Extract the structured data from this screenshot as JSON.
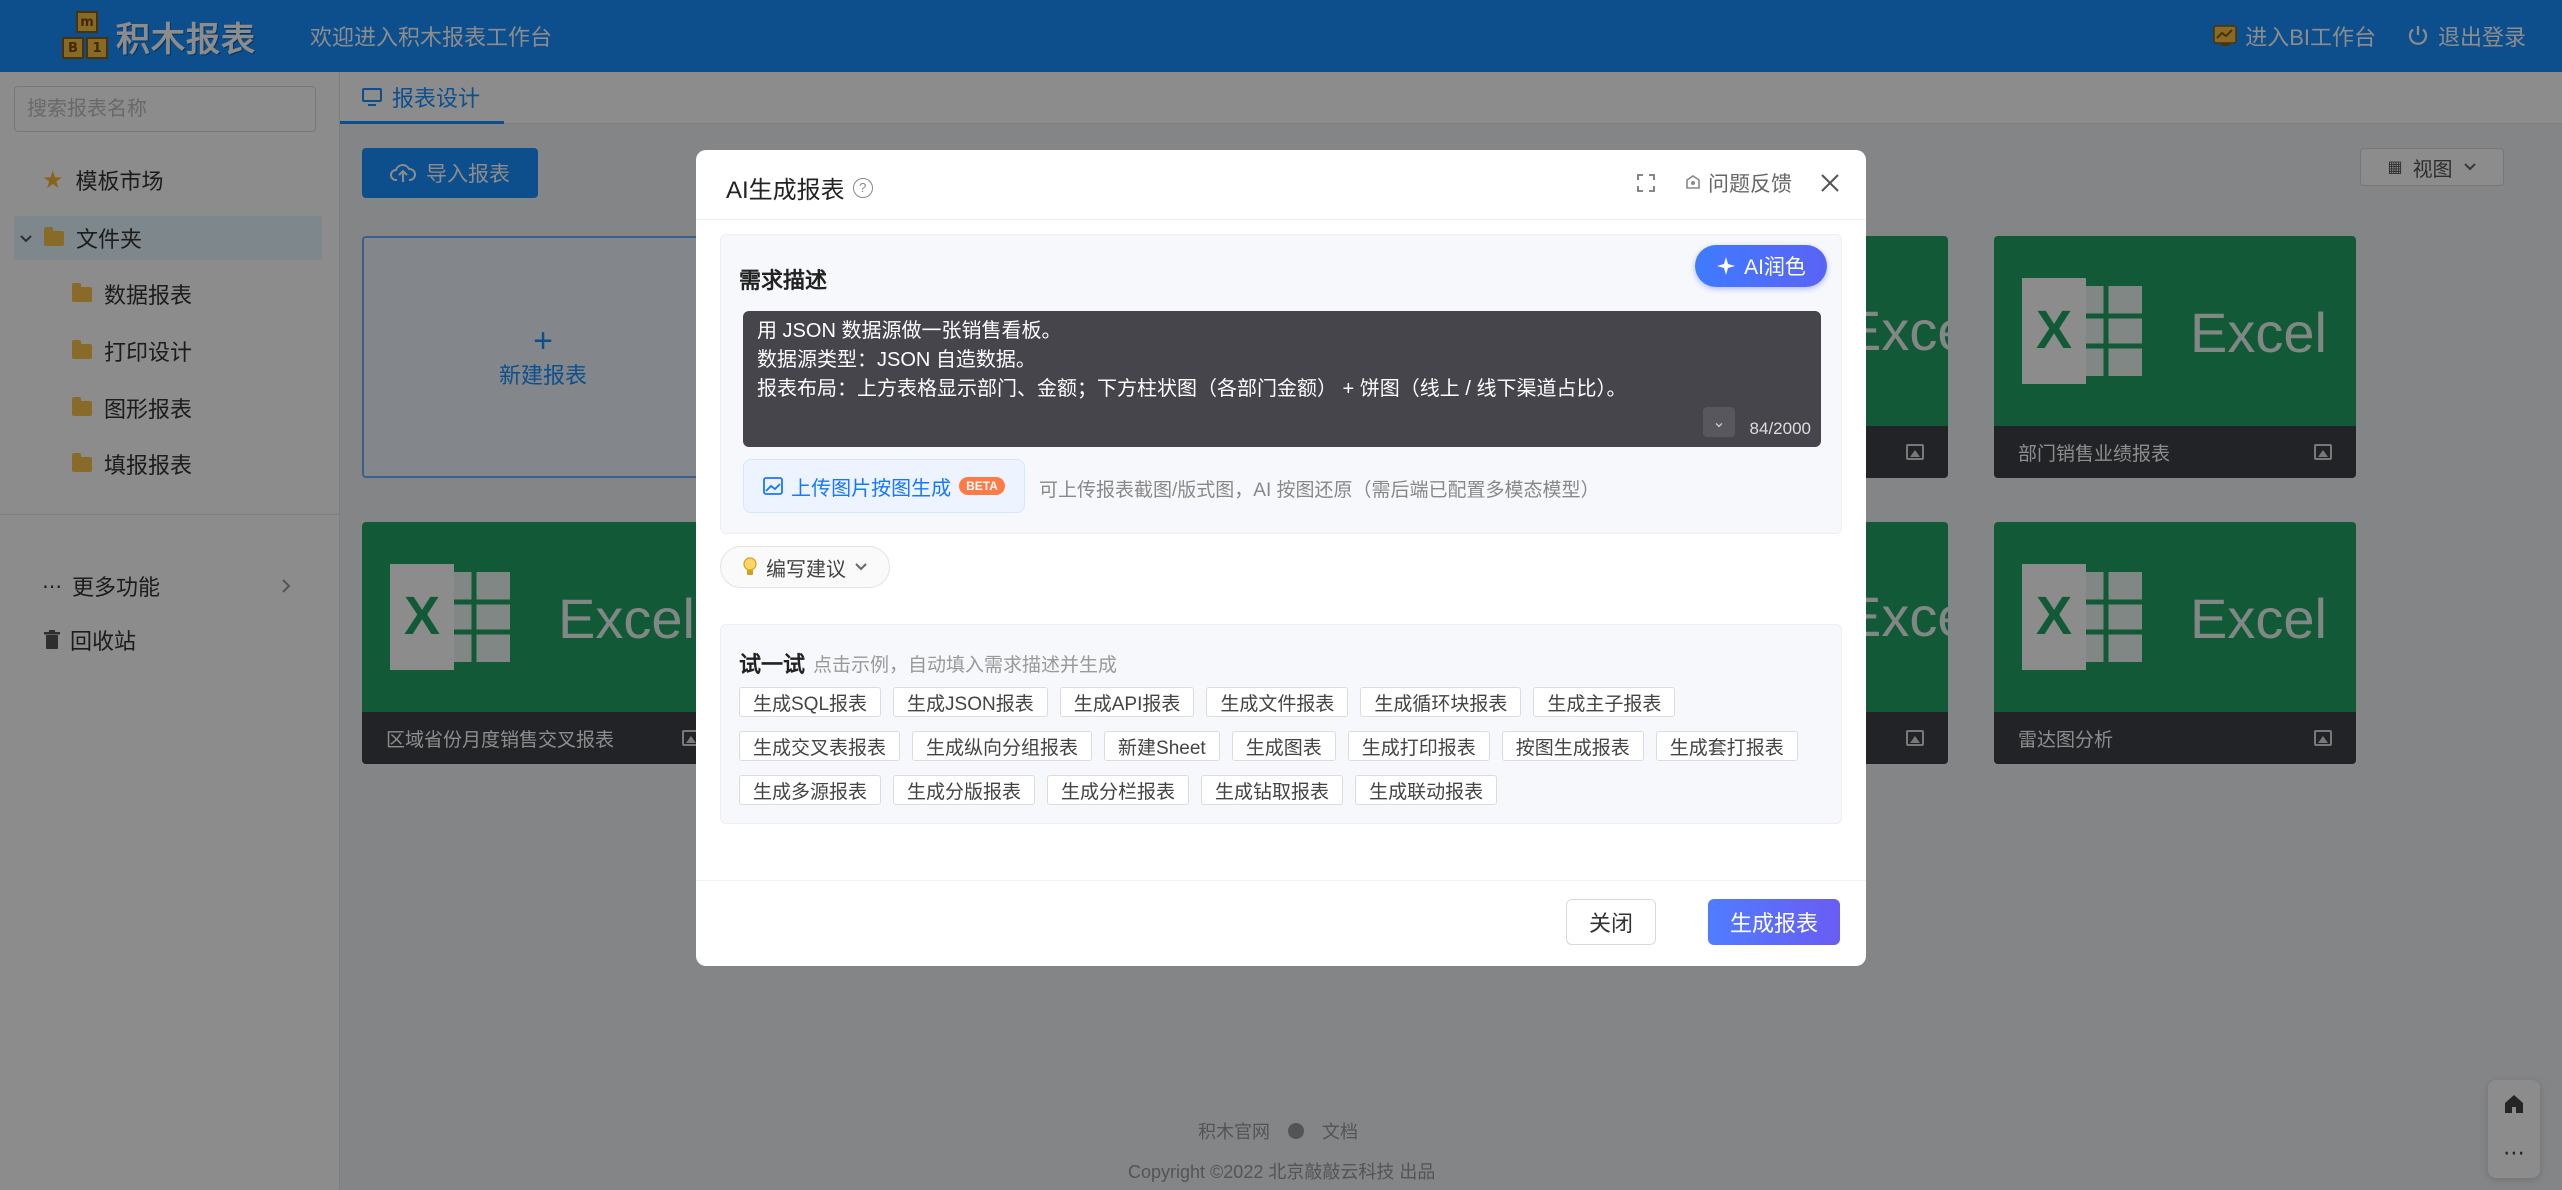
{
  "header": {
    "logo_text": "积木报表",
    "logo_blocks": [
      "m",
      "B",
      "1"
    ],
    "welcome": "欢迎进入积木报表工作台",
    "bi_link": "进入BI工作台",
    "logout": "退出登录"
  },
  "sidebar": {
    "search_placeholder": "搜索报表名称",
    "market": "模板市场",
    "folder_root": "文件夹",
    "folders": [
      "数据报表",
      "打印设计",
      "图形报表",
      "填报报表"
    ],
    "more": "更多功能",
    "recycle": "回收站"
  },
  "main": {
    "tab": "报表设计",
    "import_button": "导入报表",
    "view_label": "视图",
    "new_report": "新建报表",
    "excel_word": "Excel",
    "cards": [
      "部门销售业绩报表",
      "区域省份月度销售交叉报表",
      "雷达图分析"
    ]
  },
  "footer": {
    "site": "积木官网",
    "docs": "文档",
    "copyright": "Copyright ©2022 北京敲敲云科技 出品"
  },
  "modal": {
    "title": "AI生成报表",
    "help_mark": "?",
    "feedback": "问题反馈",
    "req_title": "需求描述",
    "ai_polish": "AI润色",
    "textarea_lines": [
      "用 JSON 数据源做一张销售看板。",
      "数据源类型：JSON 自造数据。",
      "报表布局：上方表格显示部门、金额；下方柱状图（各部门金额） + 饼图（线上 / 线下渠道占比）。"
    ],
    "char_count": "84/2000",
    "upload_button": "上传图片按图生成",
    "beta": "BETA",
    "upload_hint": "可上传报表截图/版式图，AI 按图还原（需后端已配置多模态模型）",
    "tips": "编写建议",
    "try_title": "试一试",
    "try_sub": "点击示例，自动填入需求描述并生成",
    "chips": [
      "生成SQL报表",
      "生成JSON报表",
      "生成API报表",
      "生成文件报表",
      "生成循环块报表",
      "生成主子报表",
      "生成交叉表报表",
      "生成纵向分组报表",
      "新建Sheet",
      "生成图表",
      "生成打印报表",
      "按图生成报表",
      "生成套打报表",
      "生成多源报表",
      "生成分版报表",
      "生成分栏报表",
      "生成钻取报表",
      "生成联动报表"
    ],
    "close_button": "关闭",
    "generate_button": "生成报表"
  },
  "colors": {
    "primary": "#1890ff",
    "excel_green": "#21a366",
    "gradient_start": "#4f7dff",
    "gradient_end": "#6a5cf2"
  }
}
